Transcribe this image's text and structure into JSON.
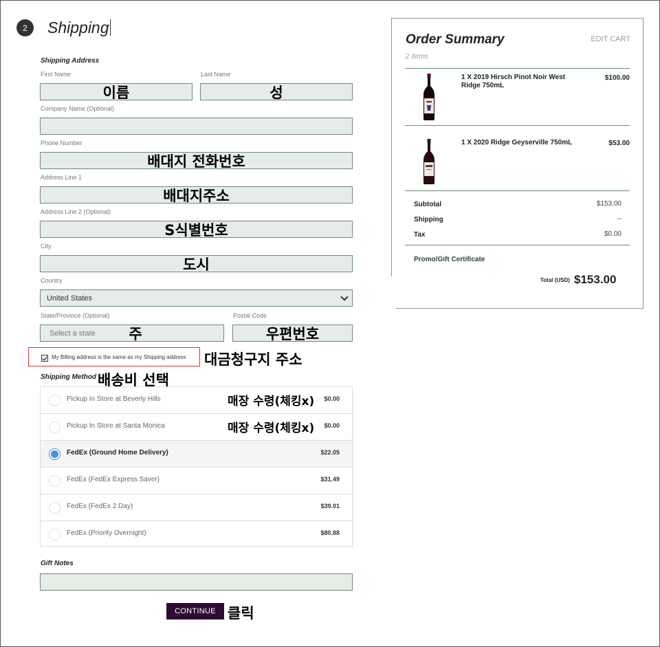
{
  "step": {
    "number": "2",
    "title": "Shipping"
  },
  "shipping_address": {
    "section_label": "Shipping Address",
    "first_name": {
      "label": "First Name",
      "annotation": "이름"
    },
    "last_name": {
      "label": "Last Name",
      "annotation": "성"
    },
    "company": {
      "label": "Company Name (Optional)"
    },
    "phone": {
      "label": "Phone Number",
      "annotation": "배대지 전화번호"
    },
    "address1": {
      "label": "Address Line 1",
      "annotation": "배대지주소"
    },
    "address2": {
      "label": "Address Line 2 (Optional)",
      "annotation": "S식별번호"
    },
    "city": {
      "label": "City",
      "annotation": "도시"
    },
    "country": {
      "label": "Country",
      "value": "United States"
    },
    "state": {
      "label": "State/Province (Optional)",
      "placeholder": "Select a state",
      "annotation": "주"
    },
    "postal": {
      "label": "Postal Code",
      "annotation": "우편번호"
    }
  },
  "billing": {
    "checkbox_label": "My Billing address is the same as my Shipping address",
    "checked": true,
    "annotation": "대금청구지 주소"
  },
  "shipping_method": {
    "section_label": "Shipping Method",
    "annotation": "배송비 선택",
    "options": [
      {
        "name": "Pickup In Store at Beverly Hills",
        "price": "$0.00",
        "selected": false,
        "annotation": "매장 수령(체킹x)"
      },
      {
        "name": "Pickup In Store at Santa Monica",
        "price": "$0.00",
        "selected": false,
        "annotation": "매장 수령(체킹x)"
      },
      {
        "name": "FedEx (Ground Home Delivery)",
        "price": "$22.05",
        "selected": true,
        "annotation": ""
      },
      {
        "name": "FedEx (FedEx Express Saver)",
        "price": "$31.49",
        "selected": false,
        "annotation": ""
      },
      {
        "name": "FedEx (FedEx 2 Day)",
        "price": "$39.01",
        "selected": false,
        "annotation": ""
      },
      {
        "name": "FedEx (Priority Overnight)",
        "price": "$80.88",
        "selected": false,
        "annotation": ""
      }
    ]
  },
  "gift_notes": {
    "section_label": "Gift Notes"
  },
  "continue": {
    "label": "CONTINUE",
    "annotation": "클릭"
  },
  "summary": {
    "title": "Order Summary",
    "edit_cart": "EDIT CART",
    "items_count": "2 Items",
    "items": [
      {
        "name": "1 X 2019 Hirsch Pinot Noir West Ridge 750mL",
        "price": "$100.00"
      },
      {
        "name": "1 X 2020 Ridge Geyserville 750mL",
        "price": "$53.00"
      }
    ],
    "subtotal_label": "Subtotal",
    "subtotal": "$153.00",
    "shipping_label": "Shipping",
    "shipping": "--",
    "tax_label": "Tax",
    "tax": "$0.00",
    "promo": "Promo/Gift Certificate",
    "total_label": "Total (USD)",
    "total": "$153.00"
  },
  "colors": {
    "field_bg": "#e6ece8",
    "field_border": "#6d8a7a",
    "button": "#2e0b33",
    "radio_selected": "#4a90e2",
    "promo": "#1f4d34",
    "highlight_box": "#dd3333"
  }
}
